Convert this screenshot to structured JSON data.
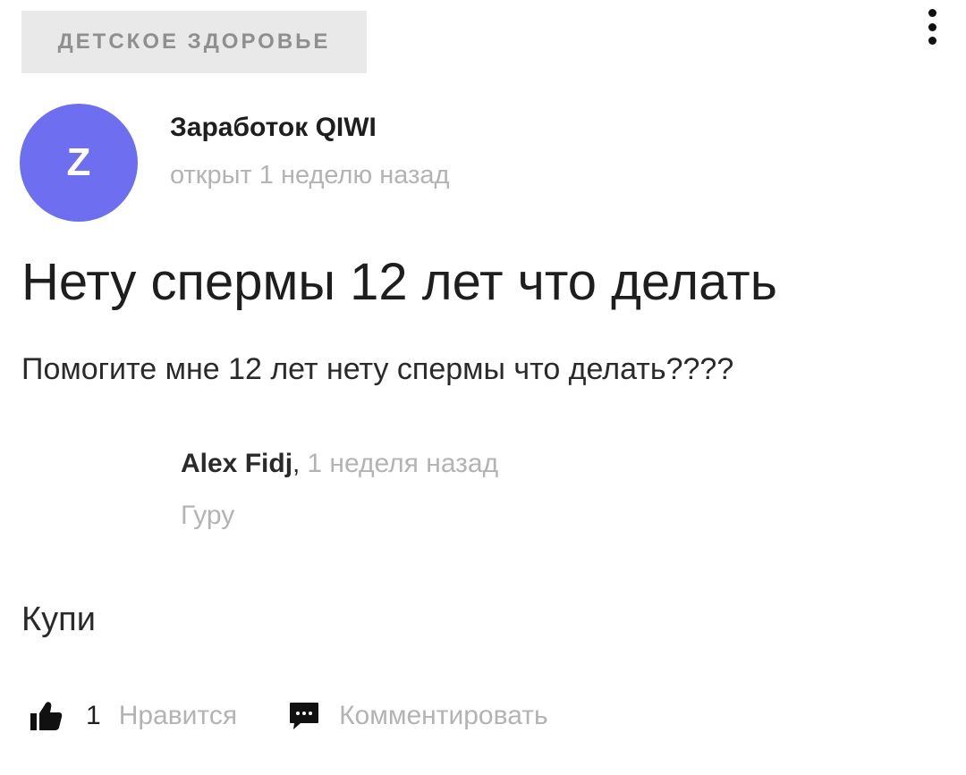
{
  "category": {
    "label": "ДЕТСКОЕ ЗДОРОВЬЕ"
  },
  "menu": {
    "icon": "more-vertical-icon"
  },
  "question": {
    "avatar_letter": "Z",
    "avatar_color": "#6d6ff0",
    "author": "Заработок QIWI",
    "opened": "открыт 1 неделю назад",
    "title": "Нету спермы 12 лет что делать",
    "body": "Помогите мне 12 лет нету спермы что делать????"
  },
  "answer": {
    "author": "Alex Fidj",
    "separator": ",",
    "time": "1 неделя назад",
    "rank": "Гуру",
    "text": "Купи"
  },
  "actions": {
    "like_icon": "thumbs-up-icon",
    "like_count": "1",
    "like_label": "Нравится",
    "comment_icon": "comment-icon",
    "comment_label": "Комментировать"
  }
}
